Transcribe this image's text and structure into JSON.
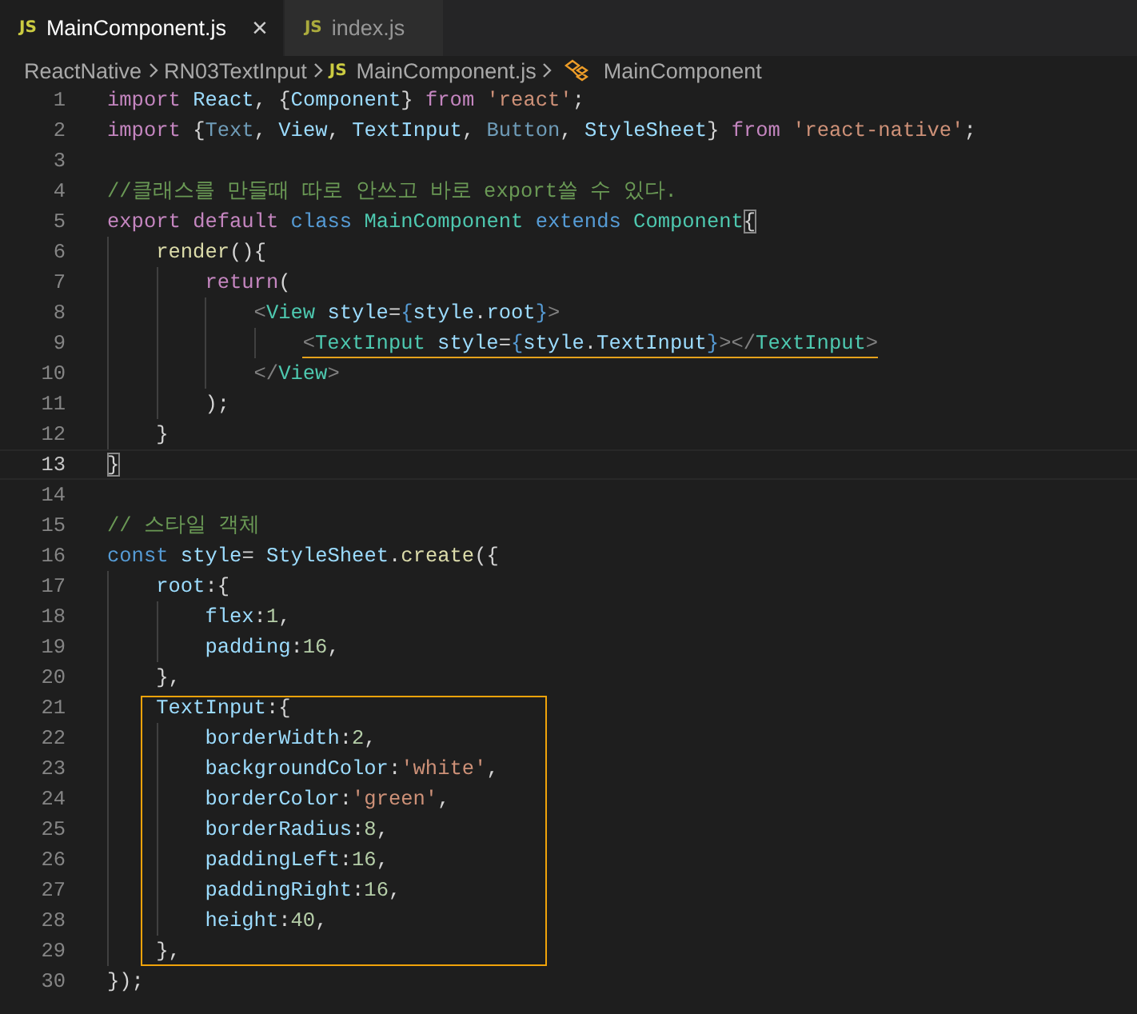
{
  "tabs": [
    {
      "icon_text": "JS",
      "label": "MainComponent.js",
      "close": "×",
      "selected": true
    },
    {
      "icon_text": "JS",
      "label": "index.js",
      "selected": false
    }
  ],
  "breadcrumb": [
    {
      "label": "ReactNative",
      "kind": "folder"
    },
    {
      "label": "RN03TextInput",
      "kind": "folder"
    },
    {
      "label": "MainComponent.js",
      "kind": "file",
      "icon_text": "JS"
    },
    {
      "label": "MainComponent",
      "kind": "class"
    }
  ],
  "lines": [
    {
      "kind": "plain",
      "number": "1",
      "tokens": [
        {
          "text": "import ",
          "kind": "keyword"
        },
        {
          "text": "React",
          "kind": "variable"
        },
        {
          "text": ", {",
          "kind": "punct"
        },
        {
          "text": "Component",
          "kind": "variable"
        },
        {
          "text": "} ",
          "kind": "punct"
        },
        {
          "text": "from ",
          "kind": "keyword"
        },
        {
          "text": "'react'",
          "kind": "string"
        },
        {
          "text": ";",
          "kind": "punct"
        }
      ]
    },
    {
      "kind": "plain",
      "number": "2",
      "tokens": [
        {
          "text": "import ",
          "kind": "keyword"
        },
        {
          "text": "{",
          "kind": "punct"
        },
        {
          "text": "Text",
          "kind": "unused"
        },
        {
          "text": ", ",
          "kind": "punct"
        },
        {
          "text": "View",
          "kind": "variable"
        },
        {
          "text": ", ",
          "kind": "punct"
        },
        {
          "text": "TextInput",
          "kind": "variable"
        },
        {
          "text": ", ",
          "kind": "punct"
        },
        {
          "text": "Button",
          "kind": "unused"
        },
        {
          "text": ", ",
          "kind": "punct"
        },
        {
          "text": "StyleSheet",
          "kind": "variable"
        },
        {
          "text": "} ",
          "kind": "punct"
        },
        {
          "text": "from ",
          "kind": "keyword"
        },
        {
          "text": "'react-native'",
          "kind": "string"
        },
        {
          "text": ";",
          "kind": "punct"
        }
      ]
    },
    {
      "kind": "plain",
      "number": "3"
    },
    {
      "kind": "plain",
      "number": "4",
      "tokens": [
        {
          "text": "//클래스를 만들때 따로 안쓰고 바로 export쓸 수 있다.",
          "kind": "comment"
        }
      ]
    },
    {
      "kind": "plain",
      "number": "5",
      "tokens": [
        {
          "text": "export ",
          "kind": "keyword"
        },
        {
          "text": "default ",
          "kind": "keyword"
        },
        {
          "text": "class ",
          "kind": "storage"
        },
        {
          "text": "MainComponent ",
          "kind": "type"
        },
        {
          "text": "extends ",
          "kind": "storage"
        },
        {
          "text": "Component",
          "kind": "type"
        },
        {
          "text": "{",
          "kind": "match"
        }
      ]
    },
    {
      "kind": "plain",
      "number": "6",
      "tokens": [
        {
          "text": "    render",
          "kind": "function"
        },
        {
          "text": "(){",
          "kind": "punct"
        }
      ]
    },
    {
      "kind": "plain",
      "number": "7",
      "tokens": [
        {
          "text": "        return",
          "kind": "keyword"
        },
        {
          "text": "(",
          "kind": "punct"
        }
      ]
    },
    {
      "kind": "plain",
      "number": "8",
      "tokens": [
        {
          "text": "            <",
          "kind": "tag"
        },
        {
          "text": "View ",
          "kind": "type"
        },
        {
          "text": "style",
          "kind": "variable"
        },
        {
          "text": "=",
          "kind": "punct"
        },
        {
          "text": "{",
          "kind": "storage"
        },
        {
          "text": "style",
          "kind": "variable"
        },
        {
          "text": ".",
          "kind": "punct"
        },
        {
          "text": "root",
          "kind": "variable"
        },
        {
          "text": "}",
          "kind": "storage"
        },
        {
          "text": ">",
          "kind": "tag"
        }
      ]
    },
    {
      "kind": "underlined",
      "number": "9",
      "tokens": [
        {
          "text": "                <",
          "kind": "tag"
        },
        {
          "text": "TextInput ",
          "kind": "type"
        },
        {
          "text": "style",
          "kind": "variable"
        },
        {
          "text": "=",
          "kind": "punct"
        },
        {
          "text": "{",
          "kind": "storage"
        },
        {
          "text": "style",
          "kind": "variable"
        },
        {
          "text": ".",
          "kind": "punct"
        },
        {
          "text": "TextInput",
          "kind": "variable"
        },
        {
          "text": "}",
          "kind": "storage"
        },
        {
          "text": "></",
          "kind": "tag"
        },
        {
          "text": "TextInput",
          "kind": "type"
        },
        {
          "text": ">",
          "kind": "tag"
        }
      ]
    },
    {
      "kind": "plain",
      "number": "10",
      "tokens": [
        {
          "text": "            </",
          "kind": "tag"
        },
        {
          "text": "View",
          "kind": "type"
        },
        {
          "text": ">",
          "kind": "tag"
        }
      ]
    },
    {
      "kind": "plain",
      "number": "11",
      "tokens": [
        {
          "text": "        );",
          "kind": "punct"
        }
      ]
    },
    {
      "kind": "plain",
      "number": "12",
      "tokens": [
        {
          "text": "    }",
          "kind": "punct"
        }
      ]
    },
    {
      "kind": "current",
      "number": "13",
      "tokens": [
        {
          "text": "}",
          "kind": "match"
        }
      ]
    },
    {
      "kind": "plain",
      "number": "14"
    },
    {
      "kind": "plain",
      "number": "15",
      "tokens": [
        {
          "text": "// 스타일 객체",
          "kind": "comment"
        }
      ]
    },
    {
      "kind": "plain",
      "number": "16",
      "tokens": [
        {
          "text": "const ",
          "kind": "storage"
        },
        {
          "text": "style",
          "kind": "variable"
        },
        {
          "text": "= ",
          "kind": "punct"
        },
        {
          "text": "StyleSheet",
          "kind": "variable"
        },
        {
          "text": ".",
          "kind": "punct"
        },
        {
          "text": "create",
          "kind": "function"
        },
        {
          "text": "({",
          "kind": "punct"
        }
      ]
    },
    {
      "kind": "plain",
      "number": "17",
      "tokens": [
        {
          "text": "    root",
          "kind": "variable"
        },
        {
          "text": ":{",
          "kind": "punct"
        }
      ]
    },
    {
      "kind": "plain",
      "number": "18",
      "tokens": [
        {
          "text": "        flex",
          "kind": "variable"
        },
        {
          "text": ":",
          "kind": "punct"
        },
        {
          "text": "1",
          "kind": "number"
        },
        {
          "text": ",",
          "kind": "punct"
        }
      ]
    },
    {
      "kind": "plain",
      "number": "19",
      "tokens": [
        {
          "text": "        padding",
          "kind": "variable"
        },
        {
          "text": ":",
          "kind": "punct"
        },
        {
          "text": "16",
          "kind": "number"
        },
        {
          "text": ",",
          "kind": "punct"
        }
      ]
    },
    {
      "kind": "plain",
      "number": "20",
      "tokens": [
        {
          "text": "    },",
          "kind": "punct"
        }
      ]
    },
    {
      "kind": "box",
      "lines": [
        {
          "kind": "plain",
          "number": "21",
          "tokens": [
            {
              "text": "    TextInput",
              "kind": "variable"
            },
            {
              "text": ":{",
              "kind": "punct"
            }
          ]
        },
        {
          "kind": "plain",
          "number": "22",
          "tokens": [
            {
              "text": "        borderWidth",
              "kind": "variable"
            },
            {
              "text": ":",
              "kind": "punct"
            },
            {
              "text": "2",
              "kind": "number"
            },
            {
              "text": ",",
              "kind": "punct"
            }
          ]
        },
        {
          "kind": "plain",
          "number": "23",
          "tokens": [
            {
              "text": "        backgroundColor",
              "kind": "variable"
            },
            {
              "text": ":",
              "kind": "punct"
            },
            {
              "text": "'white'",
              "kind": "string"
            },
            {
              "text": ",",
              "kind": "punct"
            }
          ]
        },
        {
          "kind": "plain",
          "number": "24",
          "tokens": [
            {
              "text": "        borderColor",
              "kind": "variable"
            },
            {
              "text": ":",
              "kind": "punct"
            },
            {
              "text": "'green'",
              "kind": "string"
            },
            {
              "text": ",",
              "kind": "punct"
            }
          ]
        },
        {
          "kind": "plain",
          "number": "25",
          "tokens": [
            {
              "text": "        borderRadius",
              "kind": "variable"
            },
            {
              "text": ":",
              "kind": "punct"
            },
            {
              "text": "8",
              "kind": "number"
            },
            {
              "text": ",",
              "kind": "punct"
            }
          ]
        },
        {
          "kind": "plain",
          "number": "26",
          "tokens": [
            {
              "text": "        paddingLeft",
              "kind": "variable"
            },
            {
              "text": ":",
              "kind": "punct"
            },
            {
              "text": "16",
              "kind": "number"
            },
            {
              "text": ",",
              "kind": "punct"
            }
          ]
        },
        {
          "kind": "plain",
          "number": "27",
          "tokens": [
            {
              "text": "        paddingRight",
              "kind": "variable"
            },
            {
              "text": ":",
              "kind": "punct"
            },
            {
              "text": "16",
              "kind": "number"
            },
            {
              "text": ",",
              "kind": "punct"
            }
          ]
        },
        {
          "kind": "plain",
          "number": "28",
          "tokens": [
            {
              "text": "        height",
              "kind": "variable"
            },
            {
              "text": ":",
              "kind": "punct"
            },
            {
              "text": "40",
              "kind": "number"
            },
            {
              "text": ",",
              "kind": "punct"
            }
          ]
        },
        {
          "kind": "plain",
          "number": "29",
          "tokens": [
            {
              "text": "    },",
              "kind": "punct"
            }
          ]
        }
      ]
    },
    {
      "kind": "plain",
      "number": "30",
      "tokens": [
        {
          "text": "});",
          "kind": "punct"
        }
      ]
    }
  ]
}
